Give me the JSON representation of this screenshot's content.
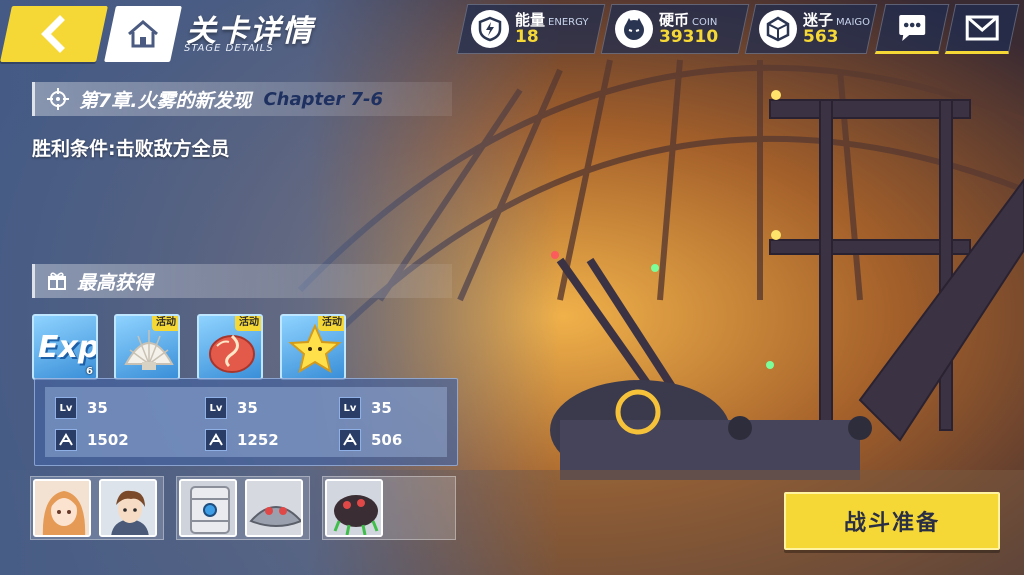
{
  "header": {
    "title": "关卡详情",
    "subtitle": "STAGE DETAILS"
  },
  "resources": [
    {
      "name": "能量",
      "name_en": "ENERGY",
      "value": "18",
      "icon": "shield-bolt-icon"
    },
    {
      "name": "硬币",
      "name_en": "COIN",
      "value": "39310",
      "icon": "cat-coin-icon"
    },
    {
      "name": "迷子",
      "name_en": "MAIGO",
      "value": "563",
      "icon": "dice-icon"
    }
  ],
  "corner_buttons": [
    {
      "icon": "chat-icon"
    },
    {
      "icon": "mail-icon"
    }
  ],
  "chapter": {
    "title": "第7章.火雾的新发现",
    "code": "Chapter 7-6"
  },
  "victory_condition": "胜利条件:击败敌方全员",
  "rewards": {
    "title": "最高获得",
    "items": [
      {
        "label": "Exp",
        "count": "6",
        "event_tag": ""
      },
      {
        "label": "",
        "count": "",
        "event_tag": "活动",
        "icon": "white-shell-icon"
      },
      {
        "label": "",
        "count": "",
        "event_tag": "活动",
        "icon": "red-shell-icon"
      },
      {
        "label": "",
        "count": "",
        "event_tag": "活动",
        "icon": "star-icon"
      }
    ]
  },
  "stats": [
    {
      "level_icon": "Lv",
      "level": "35",
      "exp": "1502"
    },
    {
      "level_icon": "Lv",
      "level": "35",
      "exp": "1252"
    },
    {
      "level_icon": "Lv",
      "level": "35",
      "exp": "506"
    }
  ],
  "team": [
    {
      "group": "characters",
      "members": [
        "girl-portrait",
        "boy-portrait"
      ]
    },
    {
      "group": "equipment",
      "members": [
        "robot-portrait",
        "drone-portrait"
      ]
    },
    {
      "group": "summon",
      "members": [
        "creature-portrait"
      ]
    }
  ],
  "battle_button": {
    "label": "战斗准备"
  },
  "colors": {
    "accent": "#f5d836",
    "panel": "#4664a0",
    "text_dark": "#2a2f45"
  }
}
